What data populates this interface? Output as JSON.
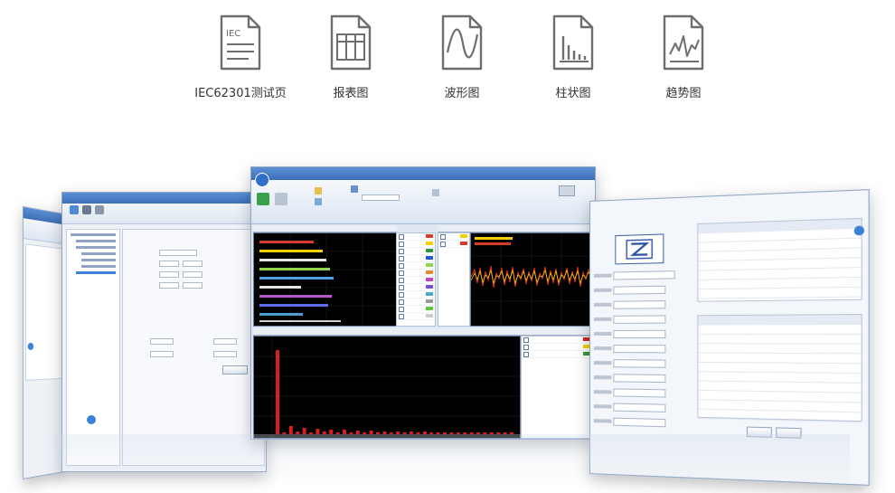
{
  "features": [
    {
      "icon": "iec-document-icon",
      "label": "IEC62301测试页",
      "badge": "IEC"
    },
    {
      "icon": "table-report-icon",
      "label": "报表图"
    },
    {
      "icon": "waveform-icon",
      "label": "波形图"
    },
    {
      "icon": "bar-chart-icon",
      "label": "柱状图"
    },
    {
      "icon": "trend-chart-icon",
      "label": "趋势图"
    }
  ],
  "colors": {
    "icon_stroke": "#6e6e6e",
    "label_text": "#333333",
    "window_frame": "#8fa6c6",
    "titlebar": "#3c6fb8",
    "plot_background": "#000000",
    "wave_yellow": "#f5d000",
    "wave_red": "#e0301e",
    "bar_red": "#d8201a",
    "accent_blue": "#3b82d6"
  }
}
